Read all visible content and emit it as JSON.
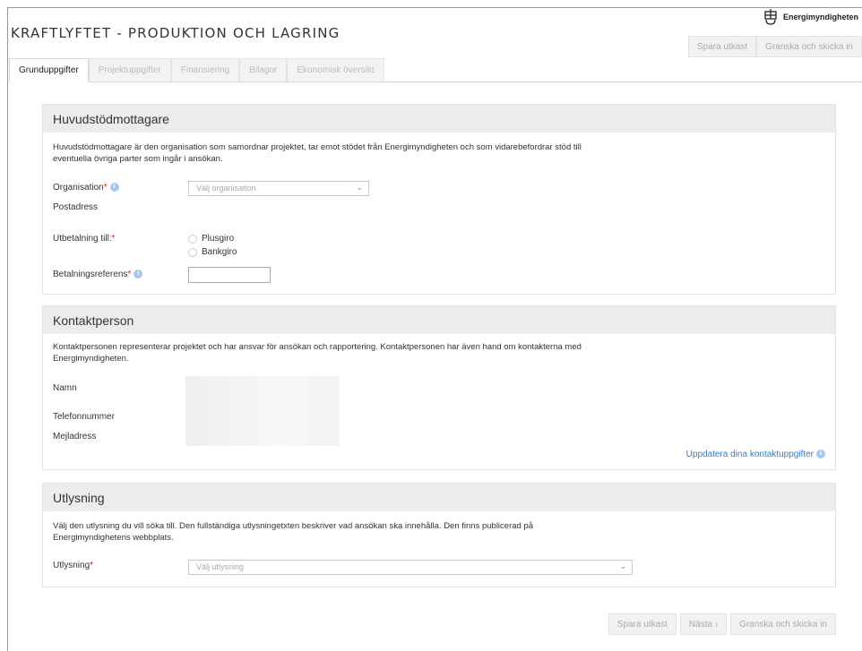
{
  "header": {
    "title": "KRAFTLYFTET - PRODUKTION OCH LAGRING",
    "logo_text": "Energimyndigheten",
    "save_draft": "Spara utkast",
    "review_submit": "Granska och skicka in"
  },
  "tabs": [
    {
      "label": "Grunduppgifter"
    },
    {
      "label": "Projektuppgifter"
    },
    {
      "label": "Finansiering"
    },
    {
      "label": "Bilagor"
    },
    {
      "label": "Ekonomisk översikt"
    }
  ],
  "recipient": {
    "title": "Huvudstödmottagare",
    "desc": "Huvudstödmottagare är den organisation som samordnar projektet, tar emot stödet från Energimyndigheten och som vidarebefordrar stöd till eventuella övriga parter som ingår i ansökan.",
    "org_label": "Organisation",
    "org_placeholder": "Välj organisation",
    "address_label": "Postadress",
    "payment_label": "Utbetalning till:",
    "plusgiro": "Plusgiro",
    "bankgiro": "Bankgiro",
    "ref_label": "Betalningsreferens"
  },
  "contact": {
    "title": "Kontaktperson",
    "desc": "Kontaktpersonen representerar projektet och har ansvar för ansökan och rapportering. Kontaktpersonen har även hand om kontakterna med Energimyndigheten.",
    "name_label": "Namn",
    "phone_label": "Telefonnummer",
    "email_label": "Mejladress",
    "update_link": "Uppdatera dina kontaktuppgifter"
  },
  "call": {
    "title": "Utlysning",
    "desc": "Välj den utlysning du vill söka till. Den fullständiga utlysningetxten beskriver vad ansökan ska innehålla. Den finns publicerad på Energimyndighetens webbplats.",
    "label": "Utlysning",
    "placeholder": "Välj utlysning"
  },
  "footer": {
    "save_draft": "Spara utkast",
    "next": "Nästa",
    "review_submit": "Granska och skicka in"
  },
  "required_mark": "*",
  "info_glyph": "i"
}
